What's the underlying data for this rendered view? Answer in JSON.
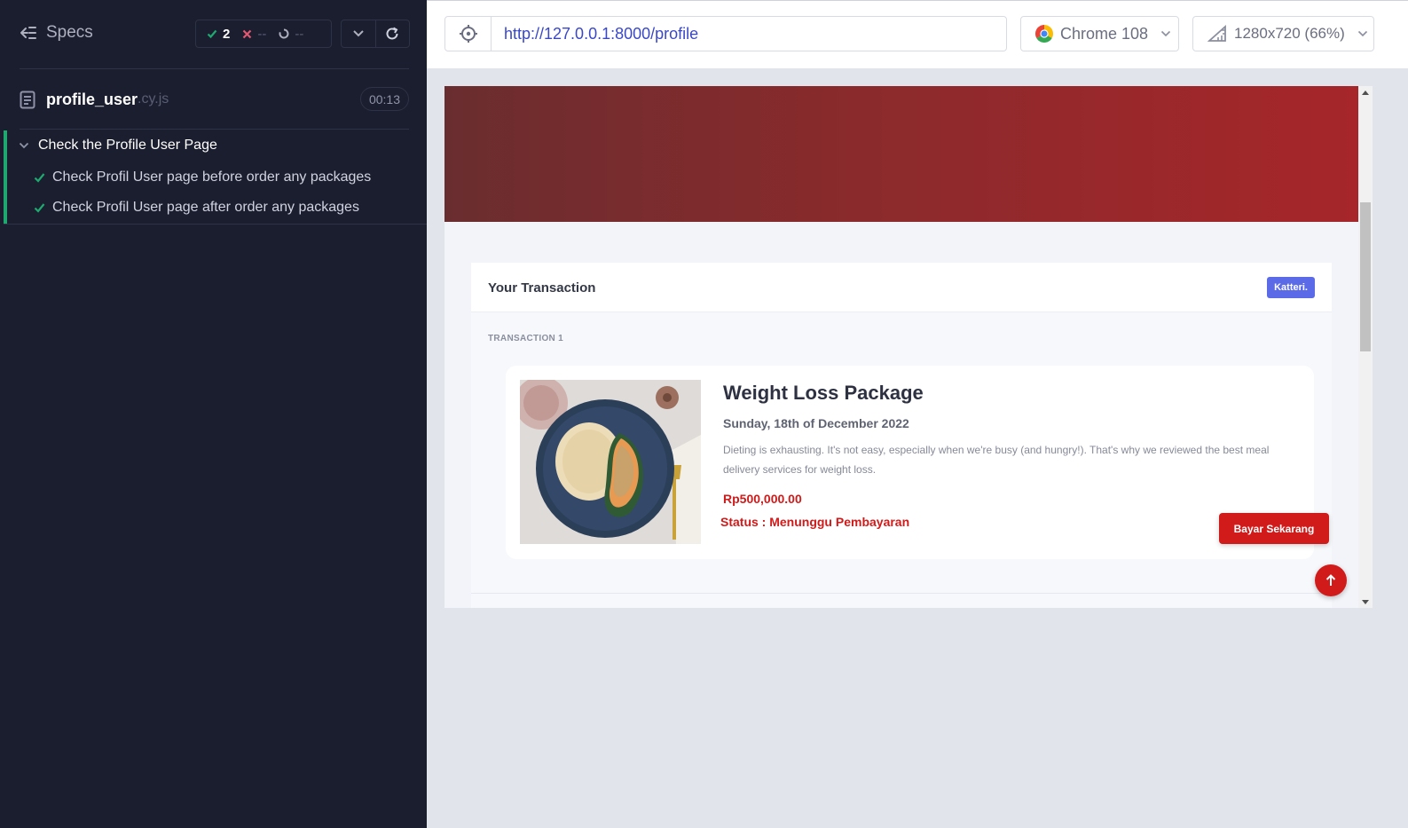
{
  "reporter": {
    "specs_label": "Specs",
    "stats": {
      "passed": "2",
      "failed": "--",
      "pending": "--"
    },
    "spec_file": {
      "name": "profile_user",
      "ext": ".cy.js",
      "duration": "00:13"
    },
    "suite": {
      "title": "Check the Profile User Page",
      "tests": [
        {
          "title": "Check Profil User page before order any packages",
          "state": "passed"
        },
        {
          "title": "Check Profil User page after order any packages",
          "state": "passed"
        }
      ]
    }
  },
  "aut": {
    "url": "http://127.0.0.1:8000/profile",
    "browser": "Chrome 108",
    "viewport": "1280x720 (66%)"
  },
  "page": {
    "card_title": "Your Transaction",
    "brand_badge": "Katteri.",
    "transaction_label": "TRANSACTION 1",
    "package": {
      "name": "Weight Loss Package",
      "date": "Sunday, 18th of December 2022",
      "description": "Dieting is exhausting. It's not easy, especially when we're busy (and hungry!). That's why we reviewed the best meal delivery services for weight loss.",
      "price": "Rp500,000.00",
      "status": "Status : Menunggu Pembayaran"
    },
    "pay_button": "Bayar Sekarang"
  },
  "colors": {
    "accent_red": "#d11a1a",
    "pass_green": "#1fa971",
    "brand_purple": "#5b6be8",
    "reporter_bg": "#1b1e2e"
  }
}
